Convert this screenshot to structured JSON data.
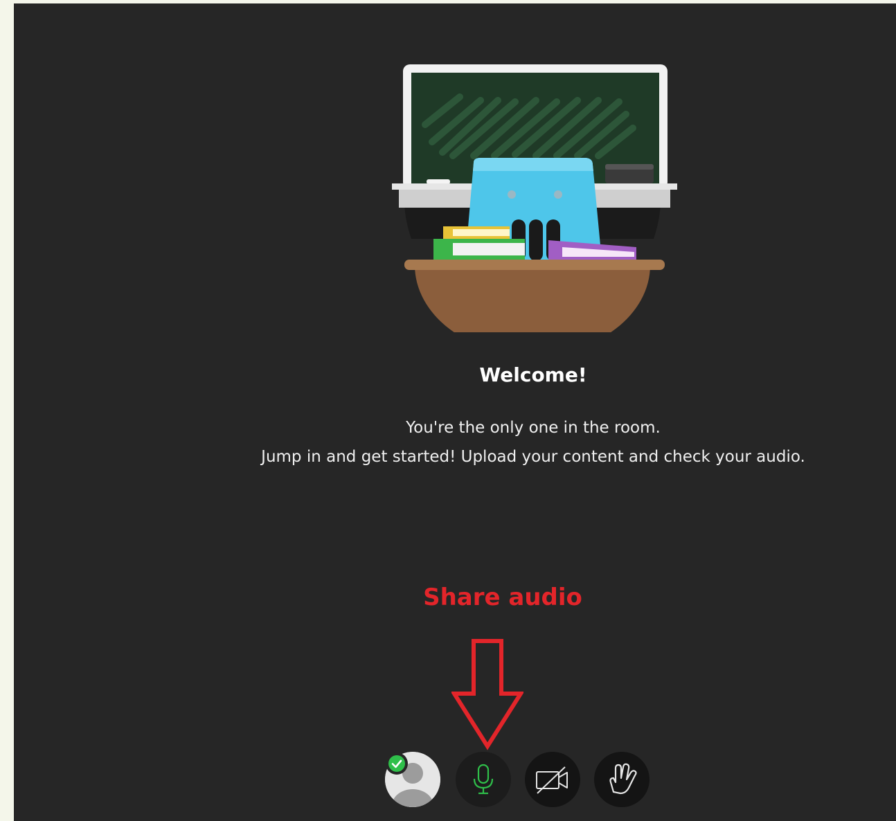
{
  "welcome": {
    "title": "Welcome!",
    "line1": "You're the only one in the room.",
    "line2": "Jump in and get started! Upload your content and check your audio."
  },
  "annotation": {
    "text": "Share audio",
    "color": "#e3252a"
  },
  "controls": {
    "avatar_icon": "user-avatar-icon",
    "status": "connected-check-icon",
    "mic_icon": "microphone-icon",
    "mic_color": "#2fbf4a",
    "camera_icon": "camera-off-icon",
    "hand_icon": "raise-hand-icon"
  },
  "colors": {
    "background": "#262626",
    "page_margin": "#f4f6ea",
    "success": "#2fbf4a"
  }
}
